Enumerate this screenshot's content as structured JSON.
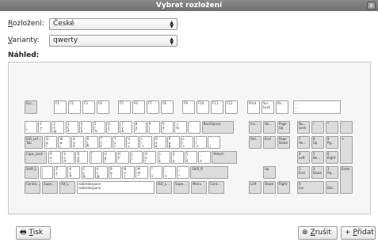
{
  "window": {
    "title": "Vybrat rozložení",
    "close": "x"
  },
  "form": {
    "layout_label_accel": "R",
    "layout_label_rest": "ozložení:",
    "layout_value": "České",
    "variant_label_accel": "V",
    "variant_label_rest": "arianty:",
    "variant_value": "qwerty",
    "preview_label": "Náhled:"
  },
  "keyboard": {
    "fn_row": [
      {
        "t": "Esc..."
      },
      {
        "t": "F1"
      },
      {
        "t": "F2"
      },
      {
        "t": "F3"
      },
      {
        "t": "F4"
      },
      {
        "t": "F5"
      },
      {
        "t": "F6"
      },
      {
        "t": "F7"
      },
      {
        "t": "F8"
      },
      {
        "t": "F9"
      },
      {
        "t": "F10"
      },
      {
        "t": "F11"
      },
      {
        "t": "F12"
      },
      {
        "t": "Print"
      },
      {
        "t": "Scr... Lock"
      },
      {
        "t": "Pa..."
      },
      {
        "t": "... ... ..."
      }
    ],
    "row1": [
      "` ; °",
      "1 + ! ~",
      "2 ě @ ˇ",
      "3 š # ^",
      "4 č $ ˘",
      "5 ř % °",
      "6 ž ^ ˛",
      "7 ý & `",
      "8 á * ˙",
      "9 í ( ´",
      "0 é ) ˝",
      "= % ¨",
      "´ ˇ ¸",
      "BackSpace"
    ],
    "row2": [
      "ISO_Lef... Tab",
      "Q q \\",
      "W w |",
      "E e €",
      "R r ¶",
      "T t ŧ",
      "Y y ←",
      "U u ↓",
      "I i →",
      "O o ø",
      "P p þ",
      "ú / ÷",
      ") ( ×",
      "¨ ' |"
    ],
    "row3": [
      "Caps_Lock",
      "A a ~",
      "S s đ",
      "D d Đ",
      "F f [",
      "G g ]",
      "H h `",
      "J j '",
      "K k ł",
      "L l Ł",
      "ů \" $",
      "§ ! ß",
      "' ¨ ¤",
      "Return"
    ],
    "row4": [
      "Shift_L",
      "| \\ /",
      "Z z °",
      "X x #",
      "C c &",
      "V v @",
      "B b {",
      "N n }",
      "M m ^",
      "? , <",
      ": . >",
      "_ - *",
      "Shift_R"
    ],
    "row5": [
      "Contro...",
      "Supe...",
      "Alt_L",
      "nobreakspace nobreakspace",
      "ISO_L...",
      "Supe...",
      "Menu",
      "Cont..."
    ],
    "nav": [
      "Ins...",
      "Ho...",
      "Page Up",
      "Del...",
      "End",
      "Page Down",
      "Up",
      "Left",
      "Down",
      "Right"
    ],
    "numpad": [
      "Nu... Lock",
      "/",
      "*",
      "-",
      "7 Ho...",
      "8 Up",
      "9 Pg...",
      "+",
      "4 Left",
      "5 Be...",
      "6 Right",
      "1 End",
      "2 Down",
      "3 Pg...",
      "Enter",
      "0 Ins",
      ". Del..."
    ]
  },
  "buttons": {
    "print_accel": "T",
    "print_rest": "isk",
    "cancel_accel": "Z",
    "cancel_rest": "rušit",
    "add_accel": "P",
    "add_rest": "řidat"
  }
}
